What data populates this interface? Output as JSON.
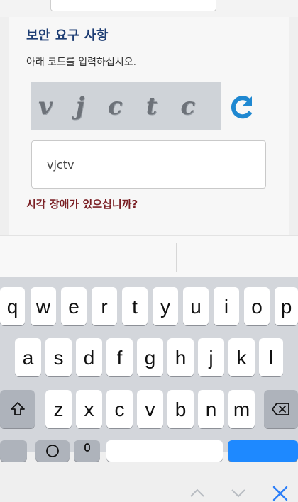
{
  "security_section": {
    "title": "보안 요구 사항",
    "instruction": "아래 코드를 입력하십시오.",
    "captcha_text": "vjctc",
    "input_value": "vjctv",
    "help_link": "시각 장애가 있으십니까?"
  },
  "colors": {
    "title": "#1d3d74",
    "help_link": "#7a1f24",
    "refresh_icon": "#1f88d1",
    "toolbar_icon": "#2d7ff9"
  },
  "keyboard": {
    "rows": [
      [
        "q",
        "w",
        "e",
        "r",
        "t",
        "y",
        "u",
        "i",
        "o",
        "p"
      ],
      [
        "a",
        "s",
        "d",
        "f",
        "g",
        "h",
        "j",
        "k",
        "l"
      ],
      [
        "z",
        "x",
        "c",
        "v",
        "b",
        "n",
        "m"
      ]
    ],
    "icons": {
      "shift": "shift-icon",
      "backspace": "backspace-icon",
      "emoji": "emoji-icon",
      "mic": "microphone-icon"
    }
  }
}
